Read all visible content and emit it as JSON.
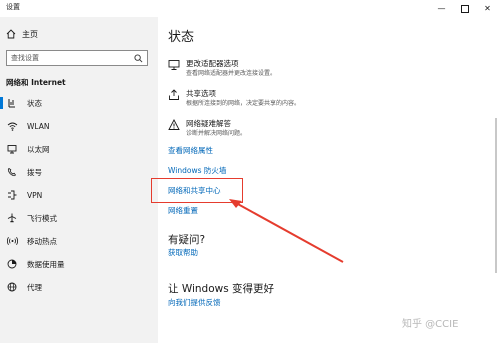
{
  "window": {
    "title": "设置"
  },
  "sidebar": {
    "home_label": "主页",
    "search_placeholder": "查找设置",
    "section_title": "网络和 Internet",
    "items": [
      {
        "label": "状态",
        "icon": "status-icon",
        "active": true
      },
      {
        "label": "WLAN",
        "icon": "wifi-icon"
      },
      {
        "label": "以太网",
        "icon": "ethernet-icon"
      },
      {
        "label": "拨号",
        "icon": "dialup-icon"
      },
      {
        "label": "VPN",
        "icon": "vpn-icon"
      },
      {
        "label": "飞行模式",
        "icon": "airplane-icon"
      },
      {
        "label": "移动热点",
        "icon": "hotspot-icon"
      },
      {
        "label": "数据使用量",
        "icon": "data-usage-icon"
      },
      {
        "label": "代理",
        "icon": "globe-icon"
      }
    ]
  },
  "main": {
    "title": "状态",
    "options": [
      {
        "title": "更改适配器选项",
        "desc": "查看网络适配器并更改连接设置。",
        "icon": "adapter-icon"
      },
      {
        "title": "共享选项",
        "desc": "根据所连接到的网络，决定要共享的内容。",
        "icon": "share-icon"
      },
      {
        "title": "网络疑难解答",
        "desc": "诊断并解决网络问题。",
        "icon": "warning-icon"
      }
    ],
    "links": {
      "properties": "查看网络属性",
      "firewall": "Windows 防火墙",
      "sharing_center": "网络和共享中心",
      "reset": "网络重置"
    },
    "questions": {
      "title": "有疑问?",
      "link": "获取帮助"
    },
    "feedback": {
      "title": "让 Windows 变得更好",
      "link": "向我们提供反馈"
    }
  },
  "annotation": {
    "color": "#e53c2e"
  },
  "accent_color": "#0078d7",
  "link_color": "#0067b8",
  "watermark": "知乎 @CCIE"
}
